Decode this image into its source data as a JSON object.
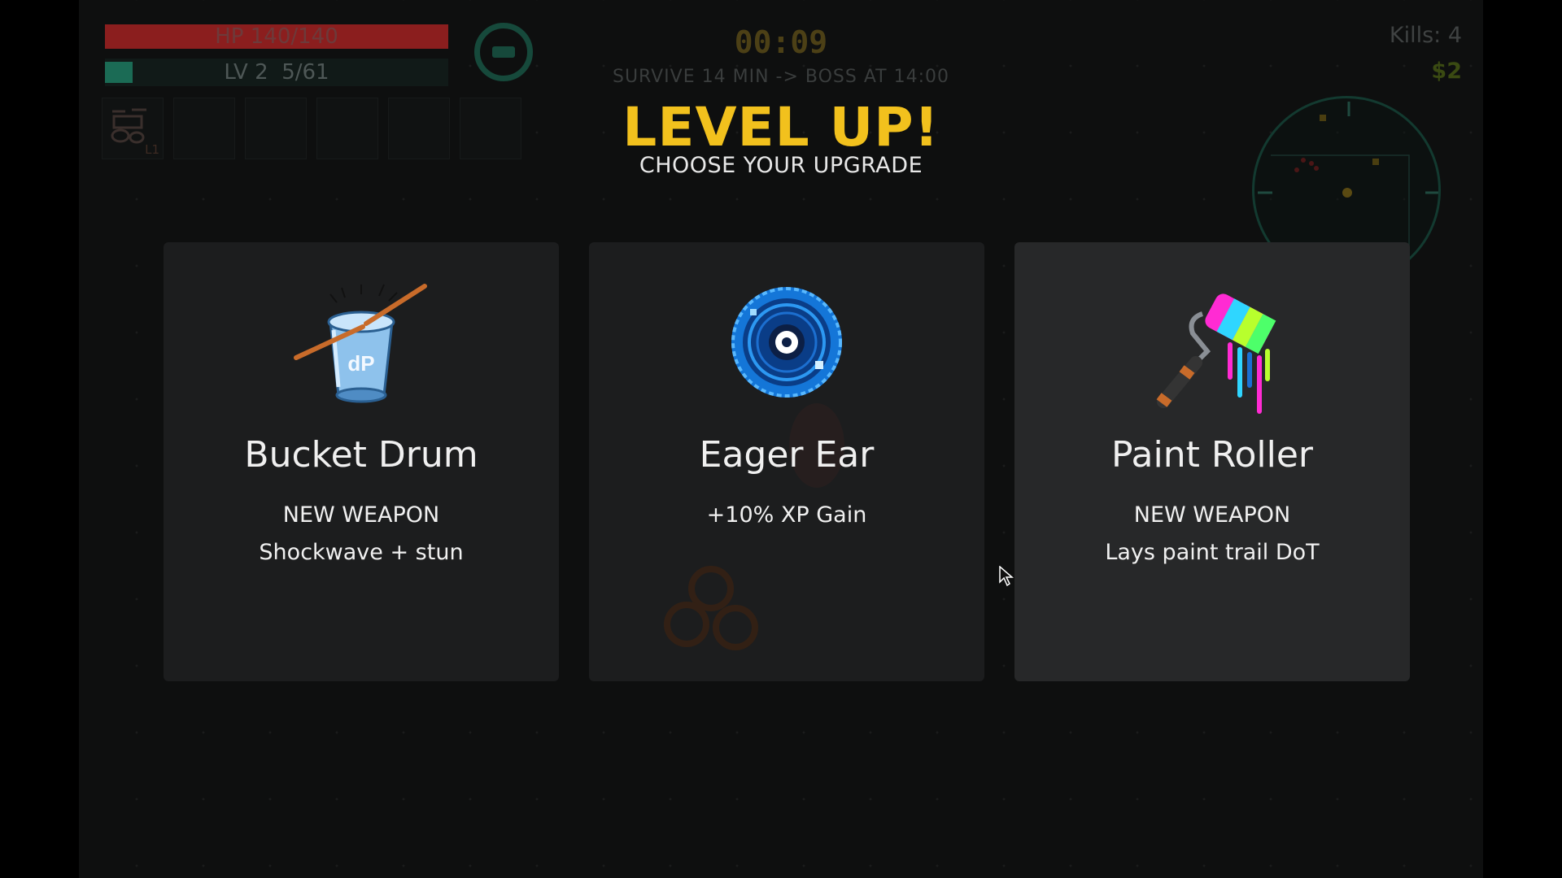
{
  "hud": {
    "hp_text": "HP 140/140",
    "hp_fraction": 1.0,
    "level_text": "LV 2",
    "xp_text": "5/61",
    "xp_fraction": 0.08,
    "timer": "00:09",
    "objective": "SURVIVE 14 MIN -> BOSS AT 14:00",
    "kills": "Kills: 4",
    "money": "$2",
    "weapon_slots": [
      {
        "icon": "drum-kit-icon",
        "level": "L1"
      },
      {
        "icon": "",
        "level": ""
      },
      {
        "icon": "",
        "level": ""
      },
      {
        "icon": "",
        "level": ""
      },
      {
        "icon": "",
        "level": ""
      },
      {
        "icon": "",
        "level": ""
      }
    ],
    "pause_icon": "pause-icon"
  },
  "level_up": {
    "title": "LEVEL UP!",
    "subtitle": "CHOOSE YOUR UPGRADE",
    "options": [
      {
        "name": "Bucket Drum",
        "tag": "NEW WEAPON",
        "desc": "Shockwave + stun",
        "icon": "bucket-drum-icon"
      },
      {
        "name": "Eager Ear",
        "tag": "",
        "desc": "+10% XP Gain",
        "icon": "vinyl-disc-icon"
      },
      {
        "name": "Paint Roller",
        "tag": "NEW WEAPON",
        "desc": "Lays paint trail DoT",
        "icon": "paint-roller-icon"
      }
    ]
  },
  "colors": {
    "title": "#f2c11d",
    "hp": "#8b1e1e",
    "xp": "#1b6b55",
    "card": "#1c1d1e",
    "card_hover": "#272829"
  }
}
